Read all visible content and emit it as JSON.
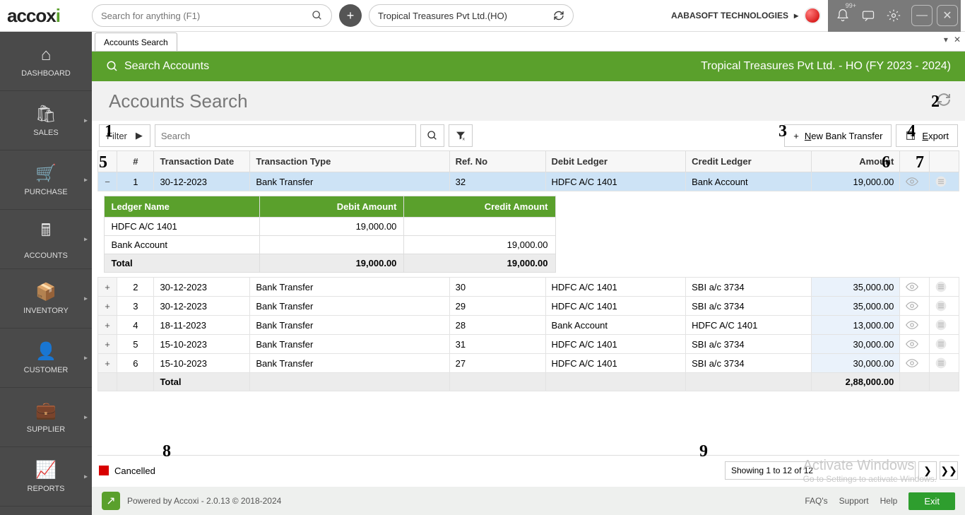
{
  "top": {
    "search_ph": "Search for anything (F1)",
    "company": "Tropical Treasures Pvt Ltd.(HO)",
    "user": "AABASOFT TECHNOLOGIES",
    "notif": "99+"
  },
  "sidebar": [
    {
      "label": "DASHBOARD",
      "icon": "⌂",
      "chev": false
    },
    {
      "label": "SALES",
      "icon": "🛍",
      "chev": true
    },
    {
      "label": "PURCHASE",
      "icon": "🛒",
      "chev": true
    },
    {
      "label": "ACCOUNTS",
      "icon": "🖩",
      "chev": true
    },
    {
      "label": "INVENTORY",
      "icon": "📦",
      "chev": true
    },
    {
      "label": "CUSTOMER",
      "icon": "👤",
      "chev": true
    },
    {
      "label": "SUPPLIER",
      "icon": "💼",
      "chev": true
    },
    {
      "label": "REPORTS",
      "icon": "📈",
      "chev": true
    }
  ],
  "tab": "Accounts Search",
  "greenbar": {
    "title": "Search Accounts",
    "right": "Tropical Treasures Pvt Ltd. - HO (FY 2023 - 2024)"
  },
  "page_title": "Accounts Search",
  "filter": {
    "label": "Filter",
    "search_ph": "Search"
  },
  "buttons": {
    "newbank": "New Bank Transfer",
    "export": "Export"
  },
  "columns": {
    "num": "#",
    "date": "Transaction Date",
    "type": "Transaction Type",
    "ref": "Ref. No",
    "debit": "Debit Ledger",
    "credit": "Credit Ledger",
    "amount": "Amount"
  },
  "rows": [
    {
      "n": "1",
      "date": "30-12-2023",
      "type": "Bank Transfer",
      "ref": "32",
      "debit": "HDFC A/C 1401",
      "credit": "Bank Account",
      "amount": "19,000.00",
      "expanded": true
    },
    {
      "n": "2",
      "date": "30-12-2023",
      "type": "Bank Transfer",
      "ref": "30",
      "debit": "HDFC A/C 1401",
      "credit": "SBI a/c 3734",
      "amount": "35,000.00"
    },
    {
      "n": "3",
      "date": "30-12-2023",
      "type": "Bank Transfer",
      "ref": "29",
      "debit": "HDFC A/C 1401",
      "credit": "SBI a/c 3734",
      "amount": "35,000.00"
    },
    {
      "n": "4",
      "date": "18-11-2023",
      "type": "Bank Transfer",
      "ref": "28",
      "debit": "Bank Account",
      "credit": "HDFC A/C 1401",
      "amount": "13,000.00"
    },
    {
      "n": "5",
      "date": "15-10-2023",
      "type": "Bank Transfer",
      "ref": "31",
      "debit": "HDFC A/C 1401",
      "credit": "SBI a/c 3734",
      "amount": "30,000.00"
    },
    {
      "n": "6",
      "date": "15-10-2023",
      "type": "Bank Transfer",
      "ref": "27",
      "debit": "HDFC A/C 1401",
      "credit": "SBI a/c 3734",
      "amount": "30,000.00"
    }
  ],
  "total_label": "Total",
  "total_amount": "2,88,000.00",
  "nested": {
    "h_name": "Ledger Name",
    "h_debit": "Debit Amount",
    "h_credit": "Credit Amount",
    "rows": [
      {
        "name": "HDFC A/C 1401",
        "debit": "19,000.00",
        "credit": ""
      },
      {
        "name": "Bank Account",
        "debit": "",
        "credit": "19,000.00"
      }
    ],
    "tot_label": "Total",
    "tot_debit": "19,000.00",
    "tot_credit": "19,000.00"
  },
  "legend": "Cancelled",
  "pager": "Showing 1 to 12 of 12",
  "footer": {
    "powered": "Powered by Accoxi - 2.0.13 © 2018-2024",
    "faqs": "FAQ's",
    "support": "Support",
    "help": "Help",
    "exit": "Exit"
  },
  "watermark": {
    "l1": "Activate Windows",
    "l2": "Go to Settings to activate Windows."
  },
  "annotations": [
    "1",
    "2",
    "3",
    "4",
    "5",
    "6",
    "7",
    "8",
    "9"
  ]
}
